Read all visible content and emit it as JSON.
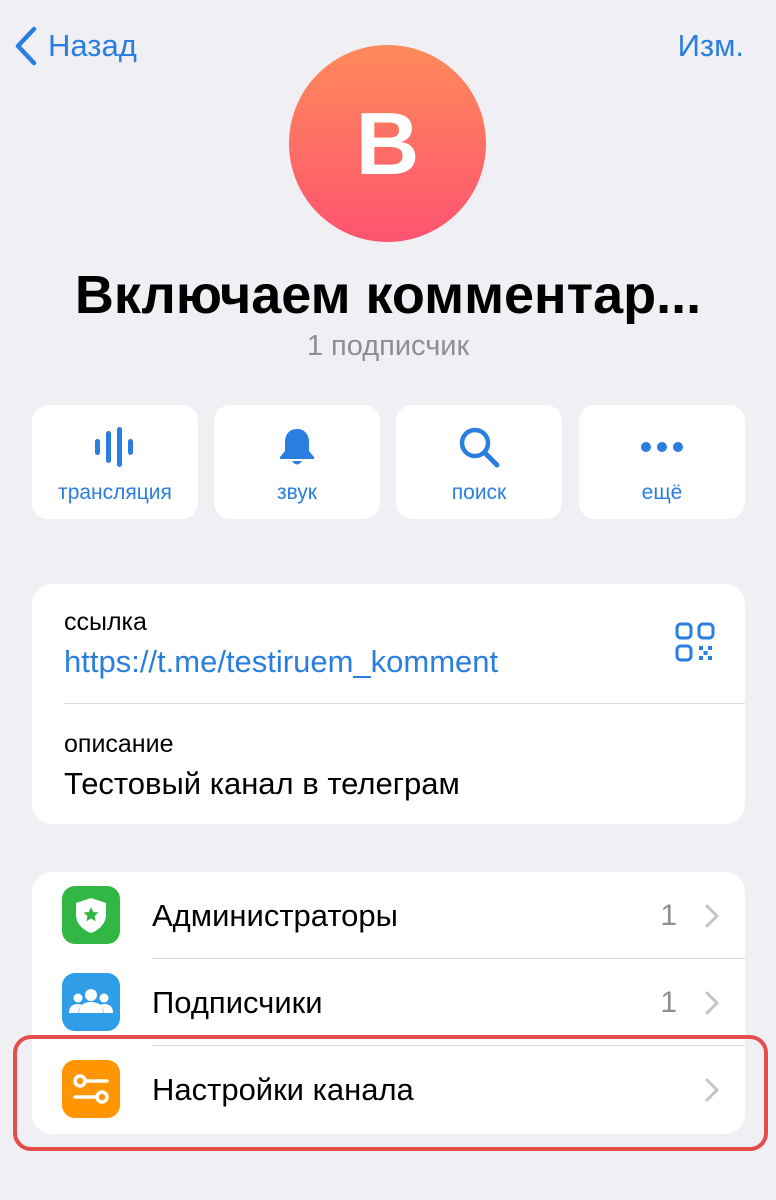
{
  "nav": {
    "back_label": "Назад",
    "edit_label": "Изм."
  },
  "channel": {
    "avatar_letter": "В",
    "title": "Включаем комментар...",
    "subtitle": "1 подписчик"
  },
  "actions": [
    {
      "label": "трансляция",
      "icon": "voice-chat-icon"
    },
    {
      "label": "звук",
      "icon": "bell-icon"
    },
    {
      "label": "поиск",
      "icon": "search-icon"
    },
    {
      "label": "ещё",
      "icon": "more-icon"
    }
  ],
  "info": {
    "link_label": "ссылка",
    "link_value": "https://t.me/testiruem_komment",
    "description_label": "описание",
    "description_value": "Тестовый канал в телеграм"
  },
  "settings": [
    {
      "label": "Администраторы",
      "count": "1",
      "icon": "admin-shield-icon",
      "color": "#33b744"
    },
    {
      "label": "Подписчики",
      "count": "1",
      "icon": "subscribers-icon",
      "color": "#2f9de8"
    },
    {
      "label": "Настройки канала",
      "count": "",
      "icon": "channel-settings-icon",
      "color": "#ff9500"
    }
  ],
  "colors": {
    "accent": "#2a7ee0",
    "highlight_border": "#e54d4d",
    "background": "#efeff4"
  }
}
